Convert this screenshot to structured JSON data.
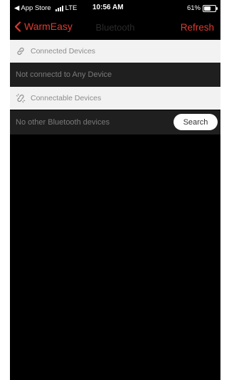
{
  "status_bar": {
    "back_app": "◀ App Store",
    "network": "LTE",
    "time": "10:56 AM",
    "battery_percent": "61%",
    "battery_level": 0.61
  },
  "nav": {
    "back_label": "WarmEasy",
    "title": "Bluetooth",
    "refresh_label": "Refresh",
    "accent_color": "#e03a2f"
  },
  "connected": {
    "header": "Connected Devices",
    "icon": "link-icon",
    "status": "Not connectd to Any Device"
  },
  "connectable": {
    "header": "Connectable Devices",
    "icon": "broken-link-icon",
    "status": "No other Bluetooth devices",
    "search_label": "Search"
  }
}
